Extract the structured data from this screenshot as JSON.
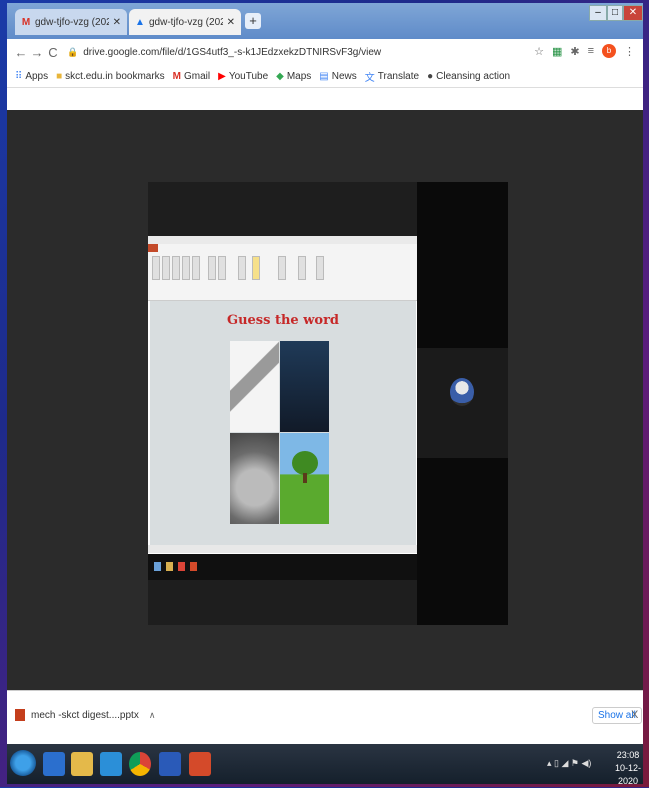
{
  "browser": {
    "tabs": [
      {
        "label": "gdw-tjfo-vzg (2020-12-10 at 02:"
      },
      {
        "label": "gdw-tjfo-vzg (2020-12-10 at 02:"
      }
    ],
    "url": "drive.google.com/file/d/1GS4utf3_-s-k1JEdzxekzDTNIRSvF3g/view",
    "avatar_letter": "b"
  },
  "bookmarks": [
    {
      "label": "Apps",
      "icon": "apps-icon"
    },
    {
      "label": "skct.edu.in bookmarks",
      "icon": "folder-icon"
    },
    {
      "label": "Gmail",
      "icon": "gmail-icon"
    },
    {
      "label": "YouTube",
      "icon": "youtube-icon"
    },
    {
      "label": "Maps",
      "icon": "maps-icon"
    },
    {
      "label": "News",
      "icon": "news-icon"
    },
    {
      "label": "Translate",
      "icon": "translate-icon"
    },
    {
      "label": "Cleansing action",
      "icon": "globe-icon"
    }
  ],
  "slide": {
    "title": "Guess the word"
  },
  "download": {
    "file": "mech -skct digest....pptx",
    "show_all": "Show all"
  },
  "taskbar": {
    "time": "23:08",
    "date": "10-12-2020"
  }
}
